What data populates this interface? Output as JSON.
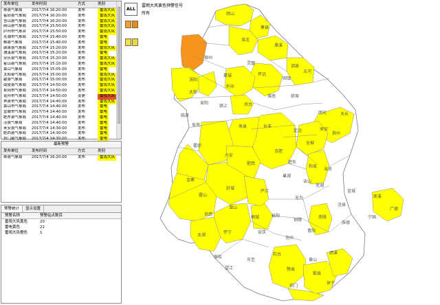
{
  "colors": {
    "yellow": "#ffff00",
    "orange": "#f7941d",
    "white": "#ffffff",
    "tag_red": "#e0522b",
    "border": "#777777",
    "label": "#555555"
  },
  "warnings_table": {
    "headers": [
      "发布单位",
      "发布时间",
      "方式",
      "类别"
    ],
    "rows": [
      [
        "寿县气象局",
        "2017/7/4 16:20:00",
        "发布",
        "雷雨大风"
      ],
      [
        "霍邱县气象局",
        "2017/7/4 16:20:00",
        "发布",
        "雷雨大风"
      ],
      [
        "含山县气象局",
        "2017/7/4 16:20:00",
        "发布",
        "雷雨大风"
      ],
      [
        "砀山县气象局",
        "2017/7/4 15:50:00",
        "发布",
        "雷雨大风"
      ],
      [
        "庐州市气象台",
        "2017/7/4 15:50:00",
        "发布",
        "雷雨大风"
      ],
      [
        "芜湖市气象局",
        "2017/7/4 15:40:00",
        "发布",
        "雷电"
      ],
      [
        "黟县气象局",
        "2017/7/4 15:40:00",
        "发布",
        "雷电"
      ],
      [
        "颍泉县气象局",
        "2017/7/4 15:20:00",
        "发布",
        "雷雨大风"
      ],
      [
        "濉溪县气象局",
        "2017/7/4 15:20:00",
        "发布",
        "雷电"
      ],
      [
        "安庆县气象局",
        "2017/7/4 15:20:00",
        "发布",
        "雷雨大风"
      ],
      [
        "霍山县气象局",
        "2017/7/4 15:10:00",
        "发布",
        "雷雨大风"
      ],
      [
        "黄山气象局",
        "2017/7/4 15:05:00",
        "发布",
        "雷电"
      ],
      [
        "太和县气象局",
        "2017/7/4 15:00:00",
        "发布",
        "雷雨大风"
      ],
      [
        "歙县气象局",
        "2017/7/4 15:00:00",
        "发布",
        "雷雨大风"
      ],
      [
        "南陵县气象局",
        "2017/7/4 14:50:00",
        "发布",
        "雷雨大风"
      ],
      [
        "阜阳市气象局",
        "2017/7/4 14:50:00",
        "发布",
        "雷雨大风"
      ],
      [
        "亳州市气象局",
        "2017/7/4 14:50:00",
        "变更",
        "雷雨大风"
      ],
      [
        "界首市气象局",
        "2017/7/4 14:40:00",
        "发布",
        "雷雨大风"
      ],
      [
        "黄山市气象局",
        "2017/7/4 14:40:00",
        "发布",
        "雷电"
      ],
      [
        "宣城市气象局",
        "2017/7/4 14:40:00",
        "发布",
        "雷电"
      ],
      [
        "肥东县气象局",
        "2017/7/4 14:40:00",
        "发布",
        "雷电"
      ],
      [
        "泾县气象局",
        "2017/7/4 14:40:00",
        "发布",
        "雷电"
      ],
      [
        "来安县气象局",
        "2017/7/4 14:30:00",
        "发布",
        "雷电"
      ],
      [
        "肥西县气象局",
        "2017/7/4 14:30:00",
        "发布",
        "雷电"
      ],
      [
        "祁门县气象局",
        "2017/7/4 14:30:00",
        "发布",
        "雷电"
      ]
    ],
    "highlighted_row": 16
  },
  "latest_panel": {
    "title": "最新预警",
    "headers": [
      "发布单位",
      "发布时间",
      "方式",
      "类别"
    ],
    "rows": [
      [
        "寿县气象局",
        "2017/7/4 16:20:00",
        "发布",
        "雷雨大风"
      ]
    ]
  },
  "stats_panel": {
    "tabs": [
      "预警统计",
      "显示设置"
    ],
    "headers": [
      "预警名称",
      "预警站点数目"
    ],
    "rows": [
      [
        "雷雨大风黄色",
        "20"
      ],
      [
        "雷电黄色",
        "22"
      ],
      [
        "雷雨大风橙色",
        "1"
      ]
    ]
  },
  "map": {
    "all_button": "ALL",
    "legend_title": "雷雨大风黄色预警信号",
    "legend_sub": "所有",
    "labels": [
      "砀山",
      "萧县",
      "淮北",
      "濉溪",
      "宿州",
      "灵璧",
      "泗县",
      "涡阳",
      "蒙城",
      "利辛",
      "怀远",
      "固镇",
      "五河",
      "太和",
      "阜阳",
      "颍上",
      "凤台",
      "淮南",
      "蚌埠",
      "明光",
      "天长",
      "临泉",
      "阜南",
      "寿县",
      "长丰",
      "定远",
      "来安",
      "全椒",
      "滁州",
      "霍邱",
      "六安",
      "肥西",
      "合肥",
      "肥东",
      "巢湖",
      "含山",
      "和县",
      "金寨",
      "霍山",
      "舒城",
      "庐江",
      "无为",
      "芜湖",
      "当涂",
      "宣城",
      "郎溪",
      "广德",
      "岳西",
      "潜山",
      "桐城",
      "枞阳",
      "铜陵",
      "南陵",
      "泾县",
      "宁国",
      "太湖",
      "怀宁",
      "安庆",
      "池州",
      "青阳",
      "旌德",
      "宿松",
      "望江",
      "东至",
      "石台",
      "黄山",
      "绩溪",
      "歙县",
      "黟县",
      "祁门",
      "休宁"
    ]
  }
}
